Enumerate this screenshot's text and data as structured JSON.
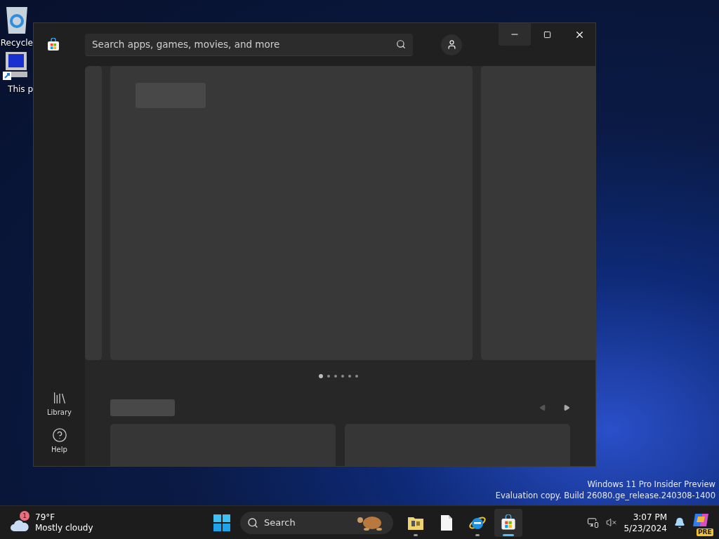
{
  "desktop": {
    "icons": [
      {
        "kind": "recycle",
        "label": "Recycle"
      },
      {
        "kind": "computer",
        "label": "This p"
      }
    ],
    "watermark": [
      "Windows 11 Pro Insider Preview",
      "Evaluation copy. Build 26080.ge_release.240308-1400"
    ]
  },
  "window": {
    "search": {
      "placeholder": "Search apps, games, movies, and more"
    },
    "nav": [
      {
        "kind": "library",
        "label": "Library"
      },
      {
        "kind": "help",
        "label": "Help"
      }
    ],
    "carousel_dots": [
      {
        "selected": true
      },
      {
        "selected": false
      },
      {
        "selected": false
      },
      {
        "selected": false
      },
      {
        "selected": false
      },
      {
        "selected": false
      }
    ]
  },
  "taskbar": {
    "weather": {
      "badge": "1",
      "temperature": "79°F",
      "condition": "Mostly cloudy"
    },
    "search": {
      "placeholder": "Search"
    },
    "apps": [
      {
        "kind": "explorer",
        "running": true,
        "active": false
      },
      {
        "kind": "notepad",
        "running": false,
        "active": false
      },
      {
        "kind": "browser",
        "running": true,
        "active": false
      },
      {
        "kind": "store",
        "running": true,
        "active": true
      }
    ],
    "time": "3:07 PM",
    "date": "5/23/2024",
    "copilot_badge": "PRE"
  }
}
